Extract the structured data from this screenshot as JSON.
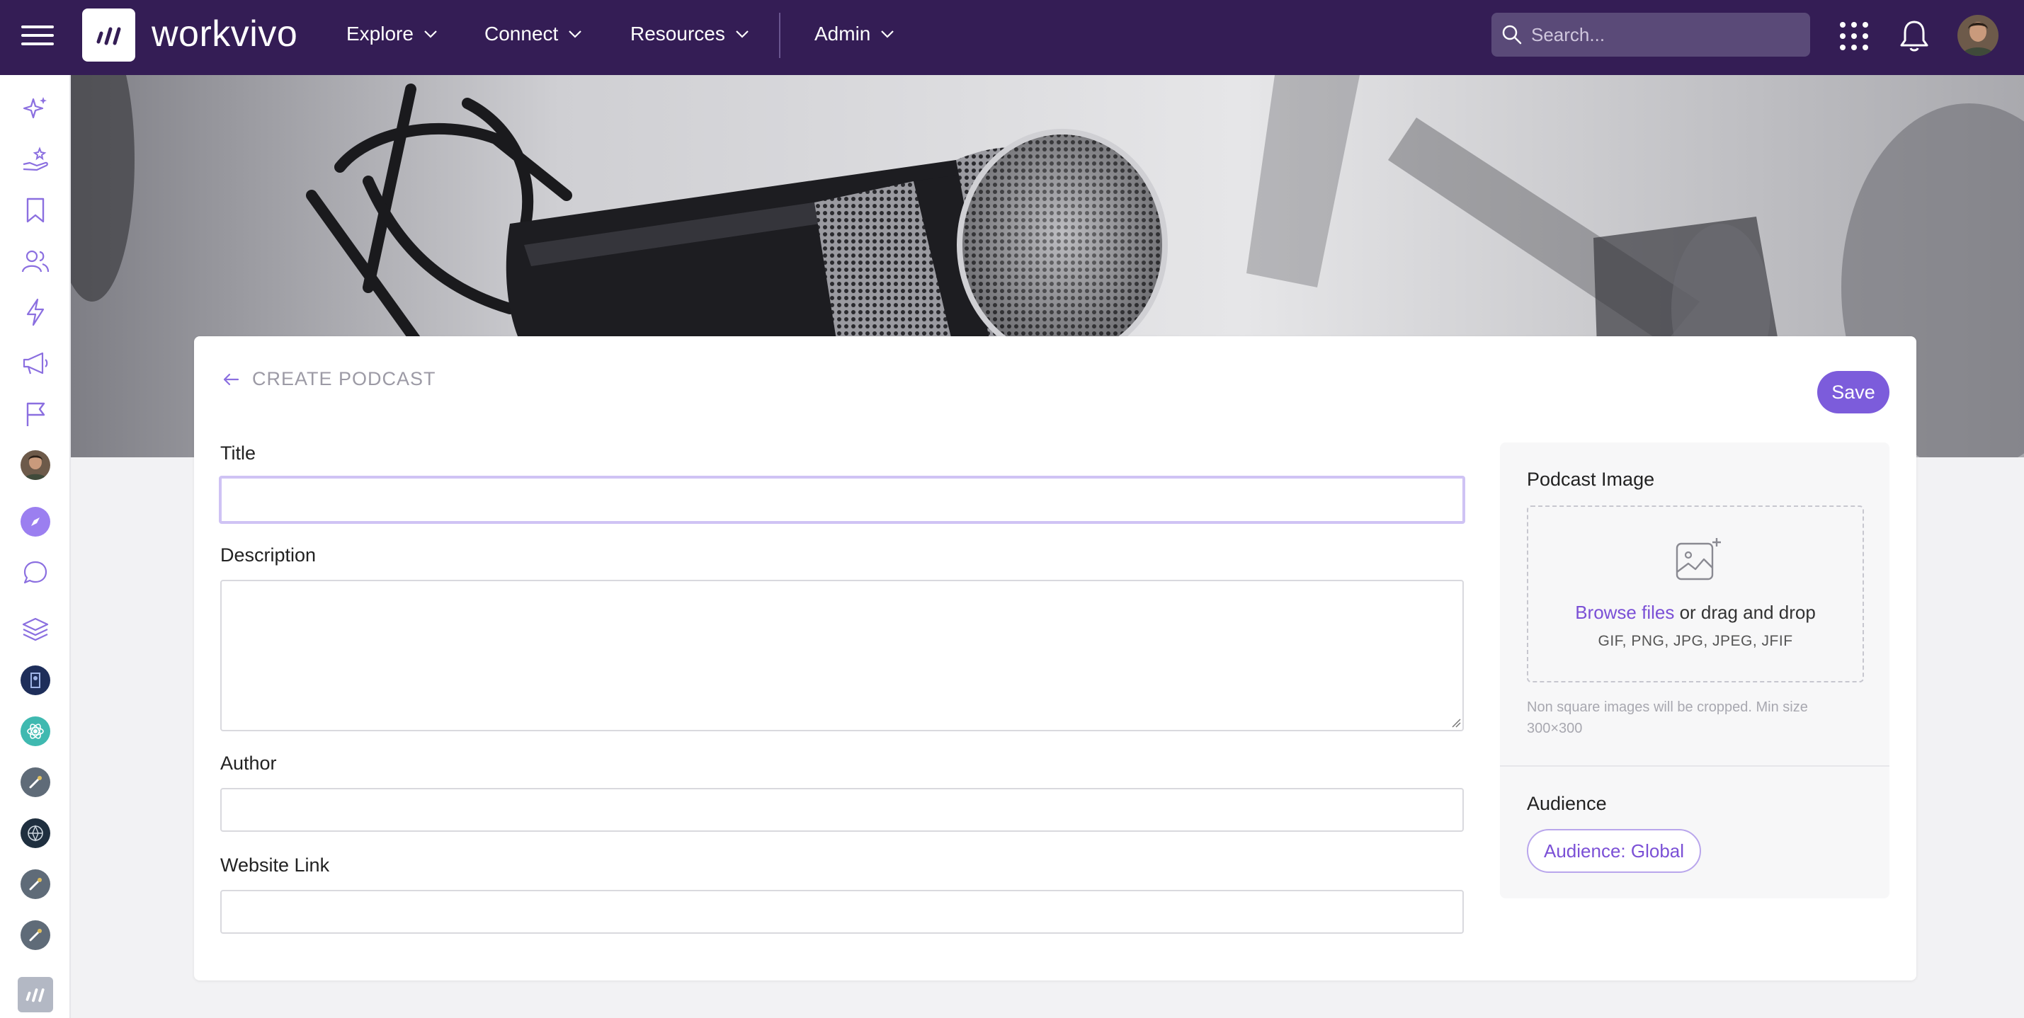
{
  "brand": {
    "name": "workvivo",
    "accent": "#7c5cdb",
    "topbar_color": "#341d55"
  },
  "nav": [
    {
      "label": "Explore"
    },
    {
      "label": "Connect"
    },
    {
      "label": "Resources"
    },
    {
      "label": "Admin"
    }
  ],
  "search": {
    "placeholder": "Search..."
  },
  "topbar_icons": [
    "hamburger-menu-icon",
    "apps-grid-icon",
    "bell-icon",
    "user-avatar"
  ],
  "sidebar": {
    "items": [
      "sparkle-icon",
      "hand-star-icon",
      "bookmark-icon",
      "people-icon",
      "lightning-icon",
      "megaphone-icon",
      "flag-icon",
      "user-avatar",
      "compass-icon",
      "chat-bubble-icon",
      "layers-icon",
      "space-avatar-1",
      "space-avatar-2",
      "space-avatar-3",
      "space-avatar-4",
      "space-avatar-5",
      "space-avatar-6",
      "workvivo-logo"
    ]
  },
  "form": {
    "title": "CREATE PODCAST",
    "save_label": "Save",
    "fields": {
      "title": {
        "label": "Title",
        "value": ""
      },
      "description": {
        "label": "Description",
        "value": ""
      },
      "author": {
        "label": "Author",
        "value": ""
      },
      "website": {
        "label": "Website Link",
        "value": ""
      }
    }
  },
  "image_panel": {
    "label": "Podcast Image",
    "browse_link": "Browse files",
    "drop_text": " or drag and drop",
    "types": "GIF, PNG, JPG, JPEG, JFIF",
    "hint": "Non square images will be cropped. Min size 300×300"
  },
  "audience": {
    "label": "Audience",
    "chip": "Audience: Global"
  }
}
